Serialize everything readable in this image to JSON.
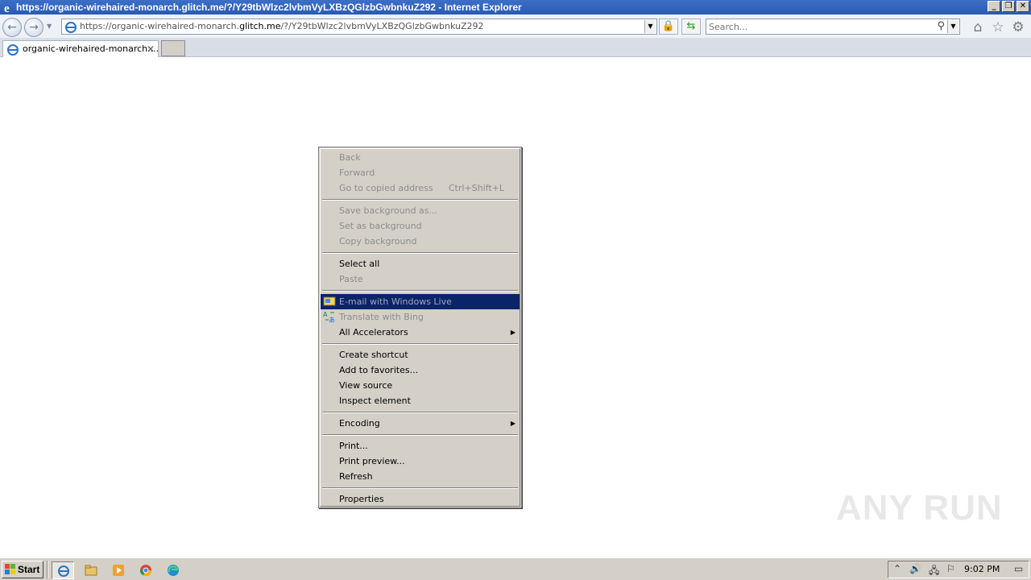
{
  "window": {
    "title": "https://organic-wirehaired-monarch.glitch.me/?/Y29tbWlzc2lvbmVyLXBzQGlzbGwbnkuZ292 - Internet Explorer",
    "controls": {
      "minimize": "_",
      "restore": "❐",
      "close": "✕"
    }
  },
  "navbar": {
    "address": {
      "prefix": "https://organic-wirehaired-monarch.",
      "host": "glitch.me",
      "suffix": "/?/Y29tbWlzc2lvbmVyLXBzQGlzbGwbnkuZ292"
    },
    "search_placeholder": "Search..."
  },
  "tabs": [
    {
      "label": "organic-wirehaired-monarch....",
      "close": "✕"
    }
  ],
  "context_menu": {
    "groups": [
      [
        {
          "label": "Back",
          "disabled": true
        },
        {
          "label": "Forward",
          "disabled": true
        },
        {
          "label": "Go to copied address",
          "shortcut": "Ctrl+Shift+L",
          "disabled": true
        }
      ],
      [
        {
          "label": "Save background as...",
          "disabled": true
        },
        {
          "label": "Set as background",
          "disabled": true
        },
        {
          "label": "Copy background",
          "disabled": true
        }
      ],
      [
        {
          "label": "Select all",
          "disabled": false
        },
        {
          "label": "Paste",
          "disabled": true
        }
      ],
      [
        {
          "label": "E-mail with Windows Live",
          "disabled": true,
          "highlighted": true,
          "icon": "windows-live-mail-icon"
        },
        {
          "label": "Translate with Bing",
          "disabled": true,
          "icon": "bing-translate-icon"
        },
        {
          "label": "All Accelerators",
          "disabled": false,
          "submenu": true
        }
      ],
      [
        {
          "label": "Create shortcut",
          "disabled": false
        },
        {
          "label": "Add to favorites...",
          "disabled": false
        },
        {
          "label": "View source",
          "disabled": false
        },
        {
          "label": "Inspect element",
          "disabled": false
        }
      ],
      [
        {
          "label": "Encoding",
          "disabled": false,
          "submenu": true
        }
      ],
      [
        {
          "label": "Print...",
          "disabled": false
        },
        {
          "label": "Print preview...",
          "disabled": false
        },
        {
          "label": "Refresh",
          "disabled": false
        }
      ],
      [
        {
          "label": "Properties",
          "disabled": false
        }
      ]
    ]
  },
  "watermark": "ANY RUN",
  "taskbar": {
    "start_label": "Start",
    "quick_launch": [
      "internet-explorer-icon",
      "file-explorer-icon",
      "media-player-icon",
      "chrome-icon",
      "edge-icon"
    ],
    "clock": "9:02 PM"
  },
  "colors": {
    "title_bar": "#2a5bb4",
    "menu_bg": "#d4d0c8",
    "menu_highlight": "#0a246a",
    "disabled_text": "#8c8c8c"
  }
}
